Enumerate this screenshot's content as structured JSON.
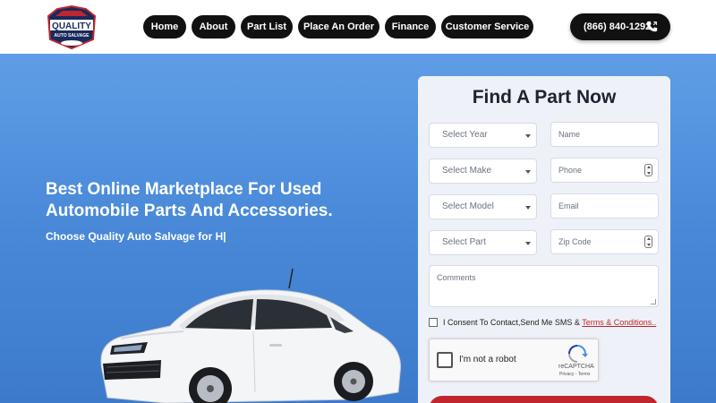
{
  "header": {
    "logo": {
      "line1": "QUALITY",
      "line2": "AUTO SALVAGE"
    },
    "nav": [
      {
        "label": "Home"
      },
      {
        "label": "About"
      },
      {
        "label": "Part List"
      },
      {
        "label": "Place An Order"
      },
      {
        "label": "Finance"
      },
      {
        "label": "Customer Service"
      }
    ],
    "phone": {
      "label": "(866) 840-1292",
      "icon": "phone-icon"
    }
  },
  "hero": {
    "title": "Best Online Marketplace For Used Automobile Parts And Accessories.",
    "subtitle": "Choose Quality Auto Salvage for H|"
  },
  "form": {
    "title": "Find A Part Now",
    "selects": [
      {
        "placeholder": "Select Year"
      },
      {
        "placeholder": "Select Make"
      },
      {
        "placeholder": "Select Model"
      },
      {
        "placeholder": "Select Part"
      }
    ],
    "inputs": [
      {
        "placeholder": "Name"
      },
      {
        "placeholder": "Phone"
      },
      {
        "placeholder": "Email"
      },
      {
        "placeholder": "Zip Code"
      }
    ],
    "comments_placeholder": "Comments",
    "consent_text": "I Consent To Contact,Send Me SMS & ",
    "terms_link": "Terms & Conditions..",
    "captcha": {
      "label": "I'm not a robot",
      "brand": "reCAPTCHA",
      "links": "Privacy - Terms"
    }
  },
  "colors": {
    "accent_red": "#c0262d",
    "nav_dark": "#111111",
    "hero_blue": "#4a8ad9"
  }
}
